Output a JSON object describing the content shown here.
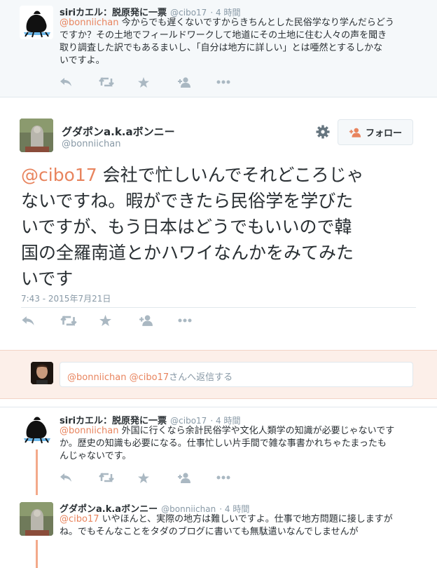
{
  "colors": {
    "accent": "#e8845e",
    "thread_line": "#f3a98a",
    "icon": "#aab8c2",
    "reply_bg": "#fcefe9",
    "ancestor_bg": "#f5f8fa"
  },
  "ancestor_tweet": {
    "name": "siriカエル：脱原発に一票",
    "handle": "@cibo17",
    "time": "· 4 時間",
    "mention": "@bonniichan",
    "text_lines": [
      "今からでも遅くないですからきちんとした民俗学なり学んだらどう",
      "ですか？その土地でフィールドワークして地道にその土地に住む人々の声を聞き",
      "取り調査した訳でもあるまいし、「自分は地方に詳しい」とは唖然とするしかな",
      "いですよ。"
    ]
  },
  "main_tweet": {
    "name": "グダポンa.k.aボンニー",
    "handle": "@bonniichan",
    "follow_label": "フォロー",
    "mention": "@cibo17",
    "text_lines": [
      "会社で忙しいんでそれどころじゃ",
      "ないですね。暇ができたら民俗学を学びた",
      "いですが、もう日本はどうでもいいので韓",
      "国の全羅南道とかハワイなんかをみてみた",
      "いです"
    ],
    "timestamp": "7:43 - 2015年7月21日"
  },
  "reply_box": {
    "mentions": "@bonniichan @cibo17",
    "suffix": "さんへ返信する"
  },
  "reply_1": {
    "name": "siriカエル：脱原発に一票",
    "handle": "@cibo17",
    "time": "· 4 時間",
    "mention": "@bonniichan",
    "text_lines": [
      "外国に行くなら余計民俗学や文化人類学の知識が必要じゃないです",
      "か。歴史の知識も必要になる。仕事忙しい片手間で雑な事書かれちゃたまったも",
      "んじゃないです。"
    ]
  },
  "reply_2": {
    "name": "グダポンa.k.aボンニー",
    "handle": "@bonniichan",
    "time": "· 4 時間",
    "mention": "@cibo17",
    "text_lines": [
      "いやほんと、実際の地方は難しいですよ。仕事で地方問題に接しますが",
      "ね。でもそんなことをタダのブログに書いても無駄遣いなんでしませんが"
    ]
  }
}
